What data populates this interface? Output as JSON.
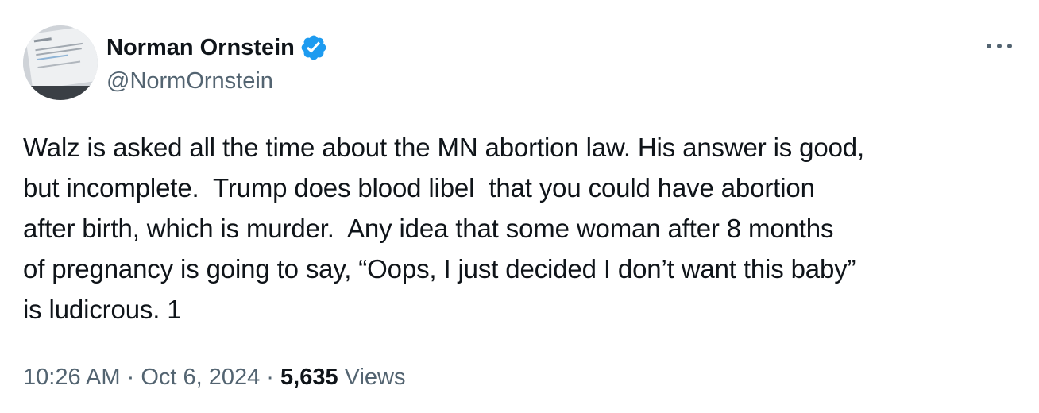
{
  "author": {
    "display_name": "Norman Ornstein",
    "handle": "@NormOrnstein",
    "verified": true,
    "verified_color": "#1d9bf0",
    "avatar_icon": "screenshot-avatar"
  },
  "more_icon": "more-dots-icon",
  "tweet": {
    "text": "Walz is asked all the time about the MN abortion law. His answer is good,\nbut incomplete.  Trump does blood libel  that you could have abortion\nafter birth, which is murder.  Any idea that some woman after 8 months\nof pregnancy is going to say, “Oops, I just decided I don’t want this baby”\nis ludicrous. 1"
  },
  "meta": {
    "time": "10:26 AM",
    "separator": " · ",
    "date": "Oct 6, 2024",
    "views_count": "5,635",
    "views_label": " Views"
  },
  "colors": {
    "text": "#0f1419",
    "secondary": "#536471",
    "background": "#ffffff"
  }
}
